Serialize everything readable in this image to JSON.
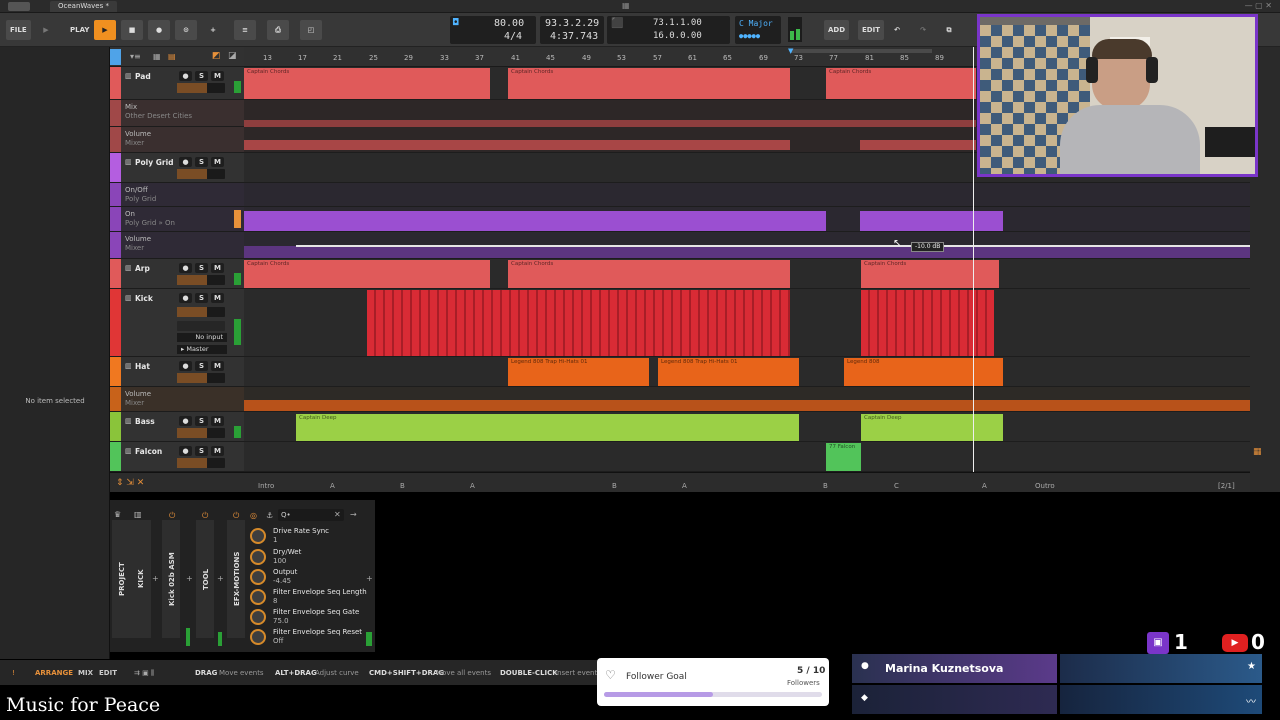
{
  "window": {
    "document_tab": "OceanWaves *"
  },
  "toolbar": {
    "file_label": "FILE",
    "play_label": "PLAY",
    "tempo": "80.00",
    "time_signature": "4/4",
    "position_bars": "93.3.2.29",
    "position_time": "4:37.743",
    "loop_start": "73.1.1.00",
    "loop_length": "16.0.0.00",
    "key": "C Major",
    "add_label": "ADD",
    "edit_label": "EDIT"
  },
  "inspector": {
    "empty_text": "No item selected"
  },
  "ruler": {
    "bars": [
      "13",
      "17",
      "21",
      "25",
      "29",
      "33",
      "37",
      "41",
      "45",
      "49",
      "53",
      "57",
      "61",
      "65",
      "69",
      "73",
      "77",
      "81",
      "85",
      "89"
    ]
  },
  "tracks": [
    {
      "name": "Pad",
      "color": "#e05a5a"
    },
    {
      "lane": "Mix",
      "sub": "Other Desert Cities"
    },
    {
      "lane": "Volume",
      "sub": "Mixer"
    },
    {
      "name": "Poly Grid",
      "color": "#b45ee0"
    },
    {
      "lane": "On/Off",
      "sub": "Poly Grid"
    },
    {
      "lane": "On",
      "sub": "Poly Grid » On"
    },
    {
      "lane": "Volume",
      "sub": "Mixer"
    },
    {
      "name": "Arp",
      "color": "#e05a5a"
    },
    {
      "name": "Kick",
      "color": "#e03636",
      "input": "No input",
      "output": "Master"
    },
    {
      "name": "Hat",
      "color": "#f07820"
    },
    {
      "lane": "Volume",
      "sub": "Mixer"
    },
    {
      "name": "Bass",
      "color": "#8ac43a"
    },
    {
      "name": "Falcon",
      "color": "#52c45a"
    }
  ],
  "clips": {
    "captain_chords": "Captain Chords",
    "captain_deep": "Captain Deep",
    "hat_clip": "Legend 808 Trap Hi-Hats 01",
    "hat_short": "Legend 808",
    "falcon_clip": "77 Falcon",
    "automation_readout": "-10.0 dB",
    "colors": {
      "pad": "#e05a5a",
      "poly": "#9b4fd1",
      "kick": "#d92b35",
      "hat": "#e8641a",
      "bass": "#9bd046",
      "falcon": "#52c45a"
    }
  },
  "cue_markers": [
    "Intro",
    "A",
    "B",
    "A",
    "B",
    "A",
    "B",
    "C",
    "A",
    "Outro"
  ],
  "cue_counter": "[2/1]",
  "devices": {
    "tabs": [
      "PROJECT",
      "KICK",
      "Kick 02b ASM",
      "TOOL",
      "EFX-MOTIONS"
    ],
    "search_placeholder": "Q•",
    "params": [
      {
        "name": "Drive Rate Sync",
        "value": "1"
      },
      {
        "name": "Dry/Wet",
        "value": "100"
      },
      {
        "name": "Output",
        "value": "-4.45"
      },
      {
        "name": "Filter Envelope Seq Length",
        "value": "8"
      },
      {
        "name": "Filter Envelope Seq Gate",
        "value": "75.0"
      },
      {
        "name": "Filter Envelope Seq Reset",
        "value": "Off"
      }
    ]
  },
  "statusbar": {
    "views": [
      "ARRANGE",
      "MIX",
      "EDIT"
    ],
    "hints": [
      {
        "key": "DRAG",
        "action": "Move events"
      },
      {
        "key": "ALT+DRAG",
        "action": "Adjust curve"
      },
      {
        "key": "CMD+SHIFT+DRAG",
        "action": "Move all events"
      },
      {
        "key": "DOUBLE-CLICK",
        "action": "Insert event"
      }
    ]
  },
  "overlay": {
    "caption": "Music for Peace",
    "follower_goal": {
      "title": "Follower Goal",
      "count": "5 / 10",
      "unit": "Followers",
      "progress": 0.5
    },
    "twitch_count": "1",
    "youtube_count": "0",
    "viewer_name": "Marina Kuznetsova"
  }
}
